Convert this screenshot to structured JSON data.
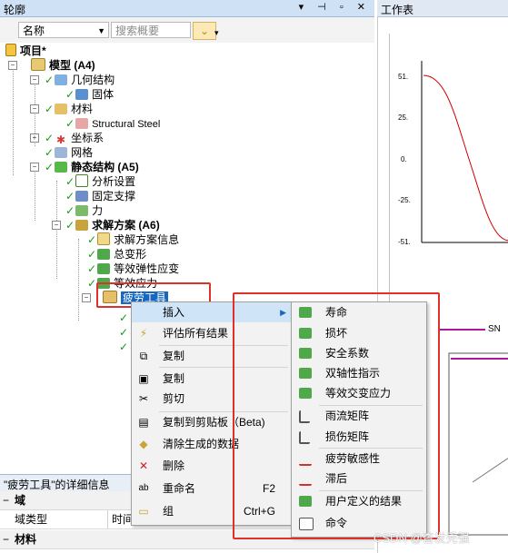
{
  "outline": {
    "title": "轮廓",
    "window_controls": "▾ ⊣ ▫ ✕",
    "name_combo": "名称",
    "search_placeholder": "搜索概要"
  },
  "tree": {
    "project": "项目*",
    "model": "模型 (A4)",
    "geometry": "几何结构",
    "solid": "固体",
    "materials": "材料",
    "structural_steel": "Structural Steel",
    "coordinate_systems": "坐标系",
    "mesh": "网格",
    "static_structural": "静态结构 (A5)",
    "analysis_settings": "分析设置",
    "fixed_support": "固定支撑",
    "force": "力",
    "solution": "求解方案 (A6)",
    "solution_info": "求解方案信息",
    "total_deformation": "总变形",
    "equivalent_elastic_strain": "等效弹性应变",
    "equivalent_stress": "等效应力",
    "fatigue_tool": "疲劳工具"
  },
  "details": {
    "title": "\"疲劳工具\"的详细信息",
    "section_domain": "域",
    "domain_type": "域类型",
    "time_col": "时间",
    "section_materials": "材料"
  },
  "worktable": {
    "title": "工作表",
    "y_ticks": [
      "51.",
      "25.",
      "0.",
      "-25.",
      "-51."
    ],
    "sn_label": "SN"
  },
  "context_menu": {
    "items": [
      {
        "label": "插入",
        "icon": "insert-icon",
        "shortcut": "",
        "submenu": true
      },
      {
        "label": "评估所有结果",
        "icon": "evaluate-icon",
        "shortcut": ""
      },
      {
        "label": "复制",
        "icon": "duplicate-icon",
        "shortcut": ""
      },
      {
        "label": "复制",
        "icon": "copy-icon",
        "shortcut": ""
      },
      {
        "label": "剪切",
        "icon": "cut-icon",
        "shortcut": ""
      },
      {
        "label": "复制到剪贴板（Beta)",
        "icon": "clipboard-icon",
        "shortcut": ""
      },
      {
        "label": "清除生成的数据",
        "icon": "clear-icon",
        "shortcut": ""
      },
      {
        "label": "删除",
        "icon": "delete-icon",
        "shortcut": ""
      },
      {
        "label": "重命名",
        "icon": "rename-icon",
        "shortcut": "F2"
      },
      {
        "label": "组",
        "icon": "group-icon",
        "shortcut": "Ctrl+G"
      }
    ]
  },
  "insert_submenu": {
    "items": [
      "寿命",
      "损坏",
      "安全系数",
      "双轴性指示",
      "等效交变应力",
      "雨流矩阵",
      "损伤矩阵",
      "疲劳敏感性",
      "滞后",
      "用户定义的结果",
      "命令"
    ]
  },
  "watermark": "CSDN @杳发秃强",
  "colors": {
    "accent": "#e0302b",
    "title_bar": "#cfe1f5",
    "check": "#1a9a1a",
    "curve": "#d00000",
    "sn_line": "#b0179e"
  }
}
